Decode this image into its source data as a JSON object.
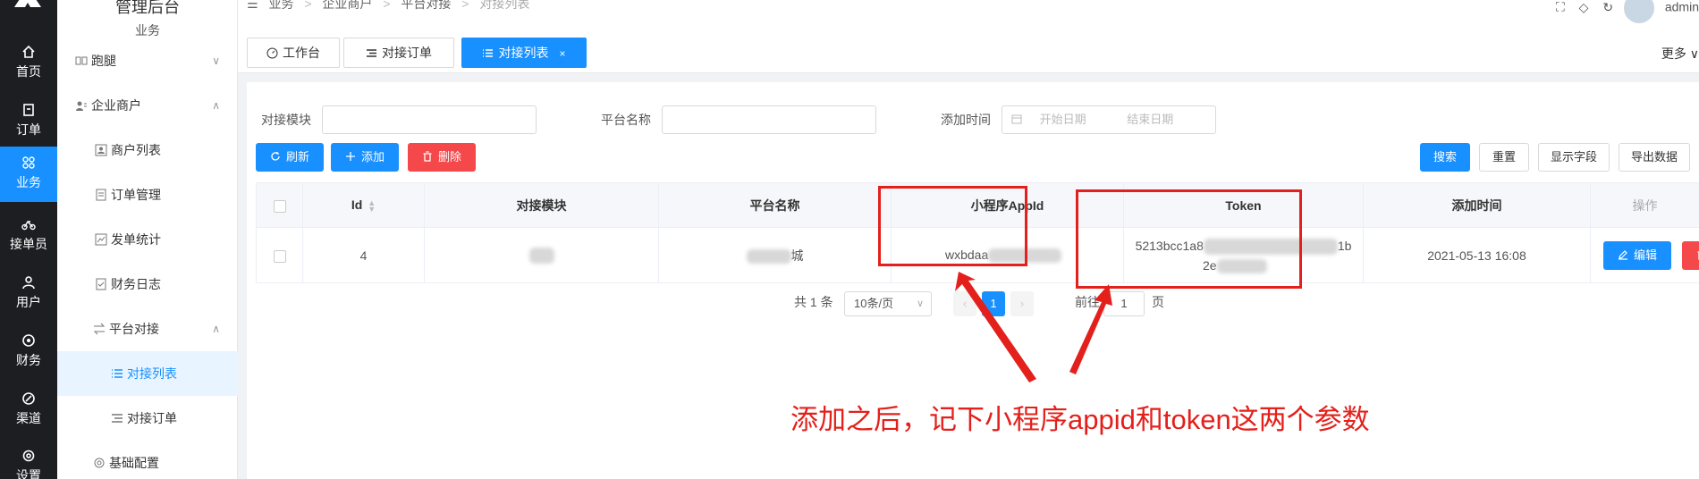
{
  "rail": {
    "items": [
      {
        "label": "首页",
        "icon": "home-icon"
      },
      {
        "label": "订单",
        "icon": "order-icon"
      },
      {
        "label": "业务",
        "icon": "grid-icon"
      },
      {
        "label": "接单员",
        "icon": "bike-icon"
      },
      {
        "label": "用户",
        "icon": "user-icon"
      },
      {
        "label": "财务",
        "icon": "money-icon"
      },
      {
        "label": "渠道",
        "icon": "channel-icon"
      },
      {
        "label": "设置",
        "icon": "gear-icon"
      }
    ],
    "active_index": 2,
    "active_color": "#1890ff"
  },
  "sidebar": {
    "header": "管理后台",
    "subheader": "业务",
    "items": [
      {
        "label": "跑腿",
        "icon": "errand-icon",
        "chevron": "∨"
      },
      {
        "label": "企业商户",
        "icon": "merchant-icon",
        "chevron": "∧"
      },
      {
        "label": "商户列表",
        "icon": "list-icon"
      },
      {
        "label": "订单管理",
        "icon": "doc-icon"
      },
      {
        "label": "发单统计",
        "icon": "chart-icon"
      },
      {
        "label": "财务日志",
        "icon": "log-icon"
      },
      {
        "label": "平台对接",
        "icon": "swap-icon",
        "chevron": "∧"
      },
      {
        "label": "对接列表",
        "icon": "list-icon"
      },
      {
        "label": "对接订单",
        "icon": "menu-icon"
      },
      {
        "label": "基础配置",
        "icon": "gear-icon"
      }
    ]
  },
  "breadcrumb": {
    "items": [
      "业务",
      "企业商户",
      "平台对接",
      "对接列表"
    ],
    "separator": ">"
  },
  "header": {
    "user": "admin"
  },
  "tabs": [
    {
      "label": "工作台",
      "icon": "dashboard-icon"
    },
    {
      "label": "对接订单",
      "icon": "menu-icon"
    },
    {
      "label": "对接列表",
      "icon": "list-icon",
      "close": "×"
    }
  ],
  "tabs_more": "更多",
  "filters": {
    "module_label": "对接模块",
    "platform_label": "平台名称",
    "time_label": "添加时间",
    "start_placeholder": "开始日期",
    "end_placeholder": "结束日期"
  },
  "toolbar": {
    "refresh": "刷新",
    "add": "添加",
    "delete": "删除",
    "search": "搜索",
    "reset": "重置",
    "columns": "显示字段",
    "export": "导出数据"
  },
  "table": {
    "columns": [
      "Id",
      "对接模块",
      "平台名称",
      "小程序AppId",
      "Token",
      "添加时间",
      "操作"
    ],
    "rows": [
      {
        "id": "4",
        "platform_suffix": "城",
        "appid_prefix": "wxbdaa",
        "token_line1_prefix": "5213bcc1a8",
        "token_line1_suffix": "1b",
        "token_line2_prefix": "2e",
        "created": "2021-05-13 16:08",
        "edit": "编辑",
        "delete": "删除"
      }
    ]
  },
  "pagination": {
    "total": "共 1 条",
    "page_size": "10条/页",
    "current": "1",
    "goto_label": "前往",
    "goto_value": "1",
    "page_unit": "页"
  },
  "annotation": {
    "text": "添加之后，记下小程序appid和token这两个参数",
    "color": "#e3201b"
  }
}
